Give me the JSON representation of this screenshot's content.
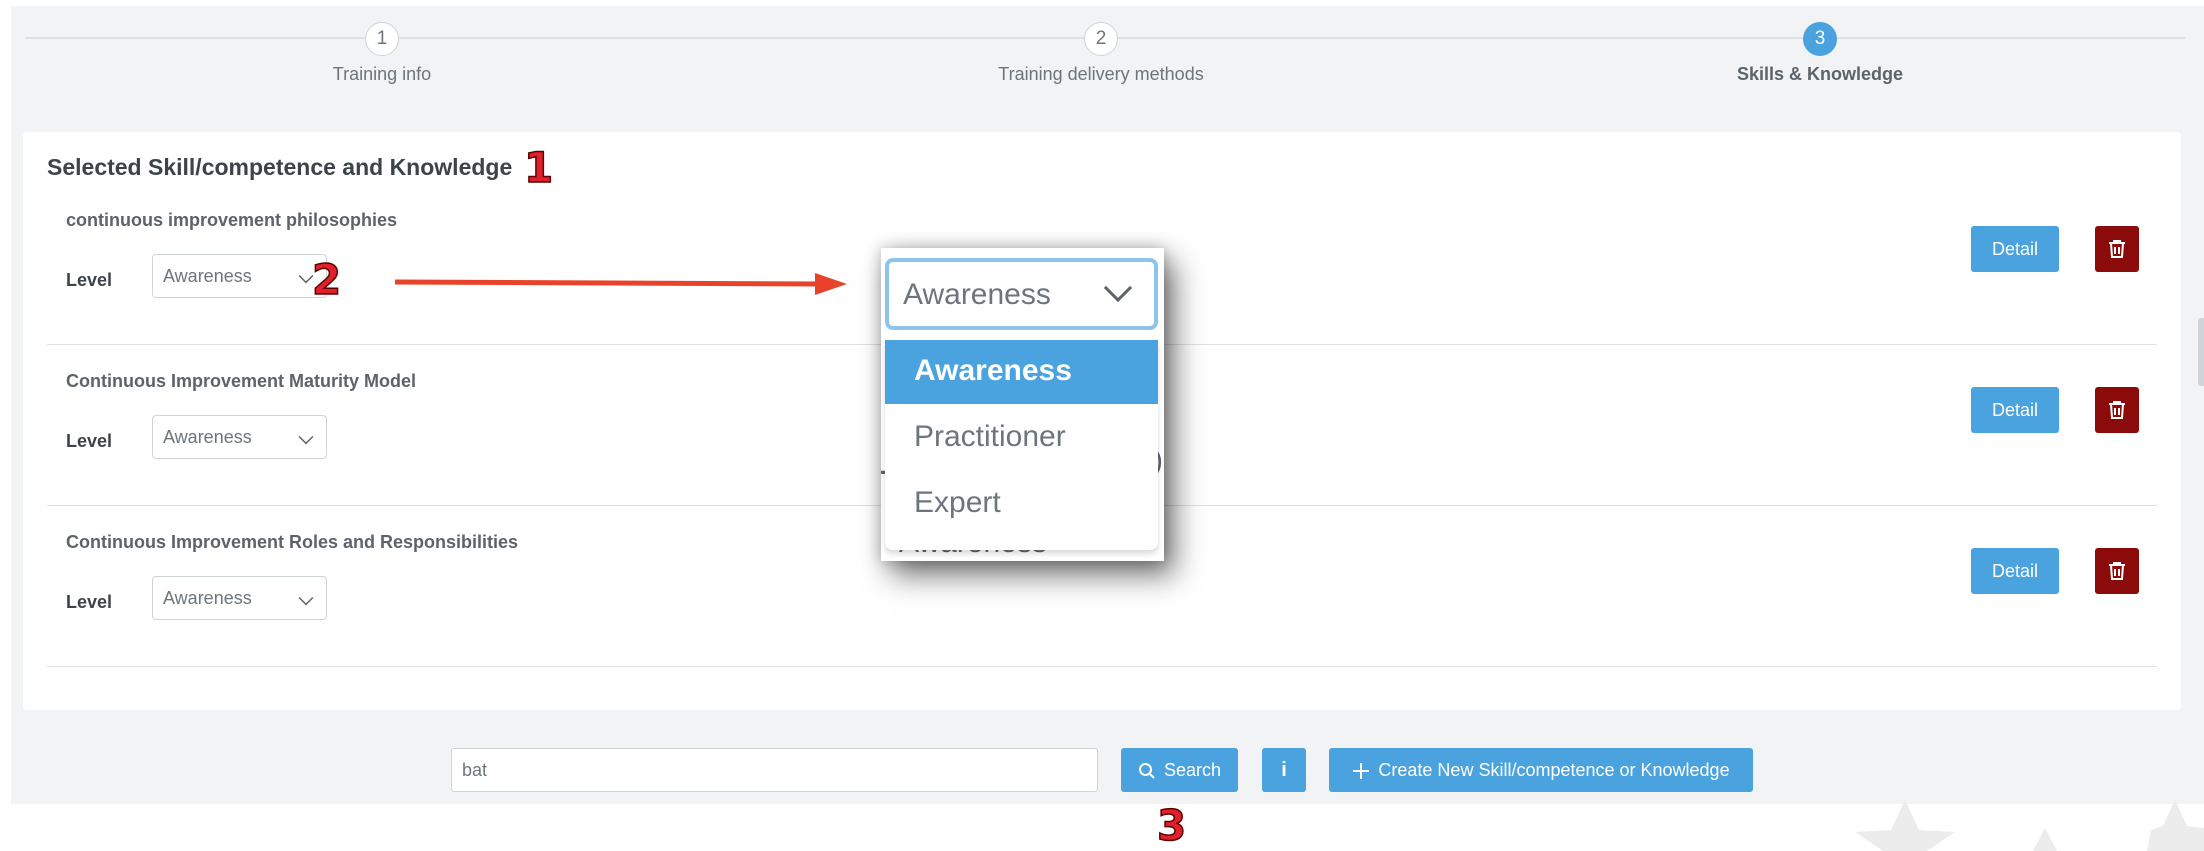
{
  "stepper": {
    "steps": [
      {
        "number": "1",
        "label": "Training info"
      },
      {
        "number": "2",
        "label": "Training delivery methods"
      },
      {
        "number": "3",
        "label": "Skills & Knowledge"
      }
    ],
    "active_step": "3"
  },
  "card": {
    "title": "Selected Skill/competence and Knowledge",
    "level_label": "Level",
    "skills": [
      {
        "name": "continuous improvement philosophies",
        "level": "Awareness",
        "detail_label": "Detail"
      },
      {
        "name": "Continuous Improvement Maturity Model",
        "level": "Awareness",
        "detail_label": "Detail"
      },
      {
        "name": "Continuous Improvement Roles and Responsibilities",
        "level": "Awareness",
        "detail_label": "Detail"
      }
    ]
  },
  "dropdown_zoom": {
    "selected": "Awareness",
    "options": [
      "Awareness",
      "Practitioner",
      "Expert"
    ]
  },
  "annotations": {
    "one": "1",
    "two": "2",
    "three": "3"
  },
  "search": {
    "value": "bat",
    "search_label": "Search",
    "info_label": "i",
    "create_label": "Create New Skill/competence or Knowledge"
  },
  "colors": {
    "primary": "#4aa3df",
    "danger": "#8b0b0b",
    "annotation": "#e0202a"
  }
}
